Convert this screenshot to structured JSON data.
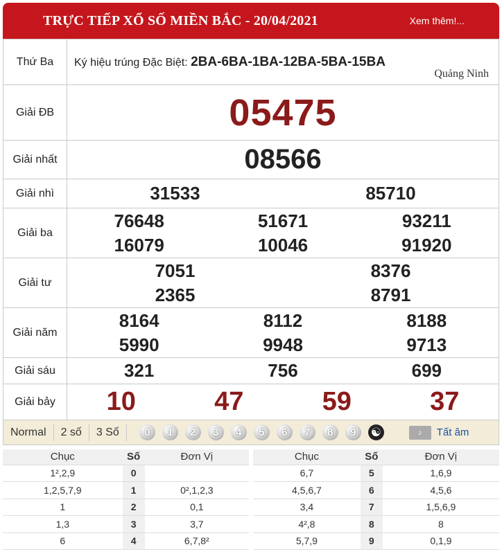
{
  "header": {
    "title": "TRỰC TIẾP XỔ SỐ MIỀN BẮC - 20/04/2021",
    "more_link": "Xem thêm!..."
  },
  "info": {
    "day": "Thứ Ba",
    "kyhieu_label": "Ký hiệu trúng Đặc Biệt:",
    "kyhieu_code": "2BA-6BA-1BA-12BA-5BA-15BA",
    "province": "Quảng Ninh"
  },
  "prizes": {
    "db": {
      "label": "Giải ĐB",
      "numbers": [
        "05475"
      ]
    },
    "nhat": {
      "label": "Giải nhất",
      "numbers": [
        "08566"
      ]
    },
    "nhi": {
      "label": "Giải nhì",
      "numbers": [
        "31533",
        "85710"
      ]
    },
    "ba": {
      "label": "Giải ba",
      "numbers": [
        "76648",
        "51671",
        "93211",
        "16079",
        "10046",
        "91920"
      ]
    },
    "tu": {
      "label": "Giải tư",
      "numbers": [
        "7051",
        "8376",
        "2365",
        "8791"
      ]
    },
    "nam": {
      "label": "Giải năm",
      "numbers": [
        "8164",
        "8112",
        "8188",
        "5990",
        "9948",
        "9713"
      ]
    },
    "sau": {
      "label": "Giải sáu",
      "numbers": [
        "321",
        "756",
        "699"
      ]
    },
    "bay": {
      "label": "Giải bảy",
      "numbers": [
        "10",
        "47",
        "59",
        "37"
      ]
    }
  },
  "toolbar": {
    "normal": "Normal",
    "two": "2 số",
    "three": "3 Số",
    "balls": [
      "0",
      "1",
      "2",
      "3",
      "4",
      "5",
      "6",
      "7",
      "8",
      "9"
    ],
    "all_sound": "Tất âm"
  },
  "loto": {
    "headers": {
      "chuc": "Chục",
      "so": "Số",
      "donvi": "Đơn Vị"
    },
    "left": [
      {
        "chuc": "1²,2,9",
        "so": "0",
        "donvi": ""
      },
      {
        "chuc": "1,2,5,7,9",
        "so": "1",
        "donvi": "0²,1,2,3"
      },
      {
        "chuc": "1",
        "so": "2",
        "donvi": "0,1"
      },
      {
        "chuc": "1,3",
        "so": "3",
        "donvi": "3,7"
      },
      {
        "chuc": "6",
        "so": "4",
        "donvi": "6,7,8²"
      }
    ],
    "right": [
      {
        "chuc": "6,7",
        "so": "5",
        "donvi": "1,6,9"
      },
      {
        "chuc": "4,5,6,7",
        "so": "6",
        "donvi": "4,5,6"
      },
      {
        "chuc": "3,4",
        "so": "7",
        "donvi": "1,5,6,9"
      },
      {
        "chuc": "4²,8",
        "so": "8",
        "donvi": "8"
      },
      {
        "chuc": "5,7,9",
        "so": "9",
        "donvi": "0,1,9"
      }
    ]
  }
}
